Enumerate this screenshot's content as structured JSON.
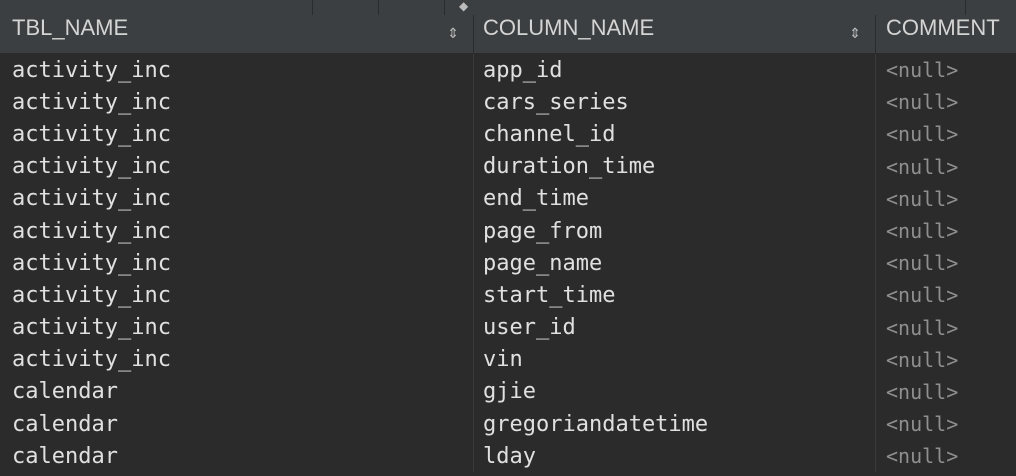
{
  "header": {
    "columns": [
      "TBL_NAME",
      "COLUMN_NAME",
      "COMMENT"
    ],
    "sort_glyph": "⇕"
  },
  "rows": [
    {
      "tbl": "activity_inc",
      "col": "app_id",
      "comment": "<null>"
    },
    {
      "tbl": "activity_inc",
      "col": "cars_series",
      "comment": "<null>"
    },
    {
      "tbl": "activity_inc",
      "col": "channel_id",
      "comment": "<null>"
    },
    {
      "tbl": "activity_inc",
      "col": "duration_time",
      "comment": "<null>"
    },
    {
      "tbl": "activity_inc",
      "col": "end_time",
      "comment": "<null>"
    },
    {
      "tbl": "activity_inc",
      "col": "page_from",
      "comment": "<null>"
    },
    {
      "tbl": "activity_inc",
      "col": "page_name",
      "comment": "<null>"
    },
    {
      "tbl": "activity_inc",
      "col": "start_time",
      "comment": "<null>"
    },
    {
      "tbl": "activity_inc",
      "col": "user_id",
      "comment": "<null>"
    },
    {
      "tbl": "activity_inc",
      "col": "vin",
      "comment": "<null>"
    },
    {
      "tbl": "calendar",
      "col": "gjie",
      "comment": "<null>"
    },
    {
      "tbl": "calendar",
      "col": "gregoriandatetime",
      "comment": "<null>"
    },
    {
      "tbl": "calendar",
      "col": "lday",
      "comment": "<null>"
    }
  ],
  "colors": {
    "background": "#2b2b2b",
    "header_bg": "#3c3f41",
    "text": "#e0e0e0",
    "null_text": "#8f8f8f"
  }
}
